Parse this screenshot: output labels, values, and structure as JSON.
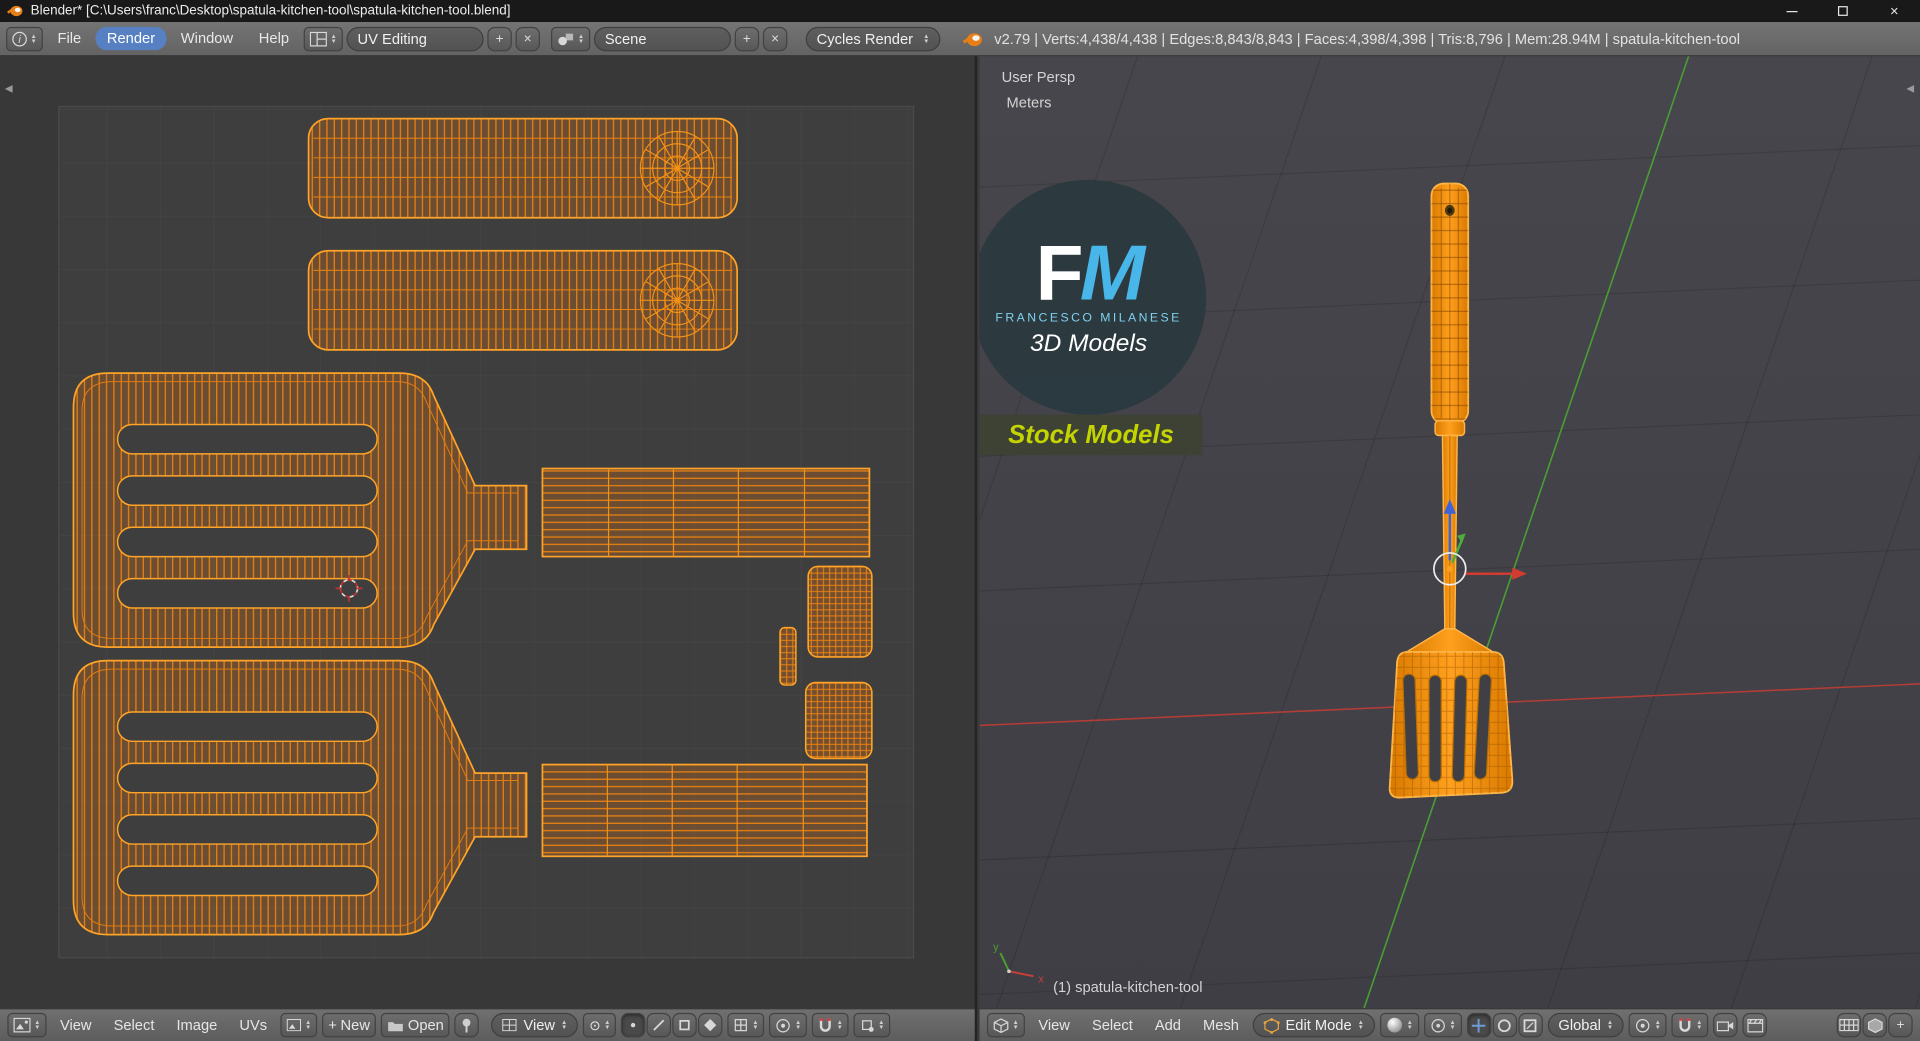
{
  "window": {
    "title": "Blender* [C:\\Users\\franc\\Desktop\\spatula-kitchen-tool\\spatula-kitchen-tool.blend]"
  },
  "infobar": {
    "menus": [
      "File",
      "Render",
      "Window",
      "Help"
    ],
    "layout": "UV Editing",
    "scene": "Scene",
    "engine": "Cycles Render",
    "stats": "v2.79 | Verts:4,438/4,438 | Edges:8,843/8,843 | Faces:4,398/4,398 | Tris:8,796 | Mem:28.94M | spatula-kitchen-tool"
  },
  "uv_editor": {
    "menus": [
      "View",
      "Select",
      "Image",
      "UVs"
    ],
    "new_button": "New",
    "open_button": "Open",
    "view_mode": "View"
  },
  "viewport_3d": {
    "projection": "User Persp",
    "units": "Meters",
    "active_object": "(1) spatula-kitchen-tool",
    "menus": [
      "View",
      "Select",
      "Add",
      "Mesh"
    ],
    "mode": "Edit Mode",
    "orientation": "Global"
  },
  "watermark": {
    "initial_f": "F",
    "initial_m": "M",
    "name": "FRANCESCO MILANESE",
    "tagline": "3D Models",
    "banner": "Stock Models"
  },
  "colors": {
    "selection_orange": "#ffa428",
    "active_menu_blue": "#5680c2",
    "axis_x_red": "#b23c36",
    "axis_y_green": "#4a9e33",
    "axis_z_blue": "#3f62d9",
    "watermark_blue": "#49b6e9",
    "banner_yellow": "#c3d400"
  }
}
